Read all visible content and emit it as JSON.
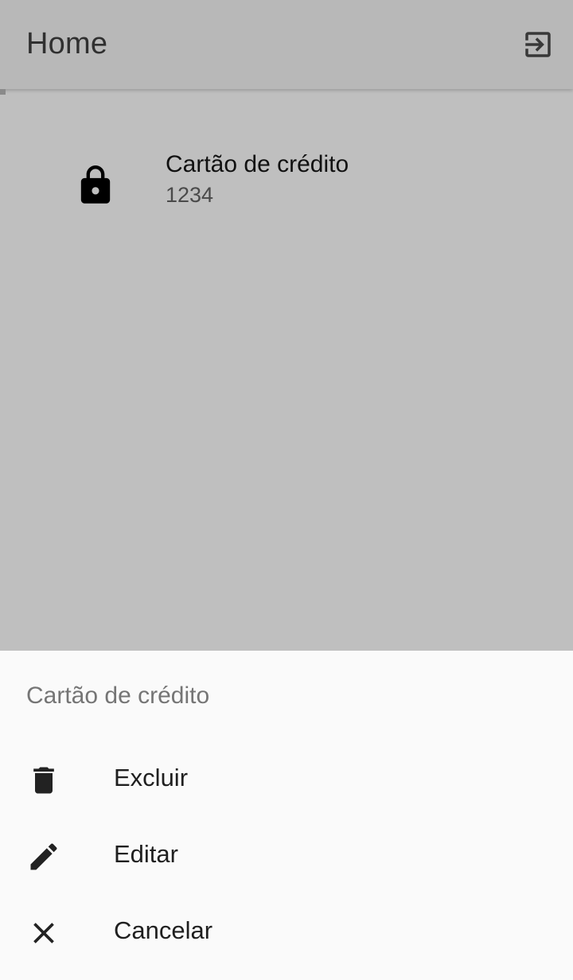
{
  "appbar": {
    "title": "Home",
    "logout_icon": "logout-icon"
  },
  "list": {
    "items": [
      {
        "icon": "lock-icon",
        "title": "Cartão de crédito",
        "subtitle": "1234"
      }
    ]
  },
  "sheet": {
    "header": "Cartão de crédito",
    "actions": [
      {
        "icon": "trash-icon",
        "label": "Excluir"
      },
      {
        "icon": "edit-pencil-icon",
        "label": "Editar"
      },
      {
        "icon": "close-icon",
        "label": "Cancelar"
      }
    ]
  },
  "colors": {
    "scrim_background": "#bfbfbf",
    "appbar_background": "#b8b8b8",
    "sheet_background": "#fafafa",
    "icon_color": "#222222"
  }
}
